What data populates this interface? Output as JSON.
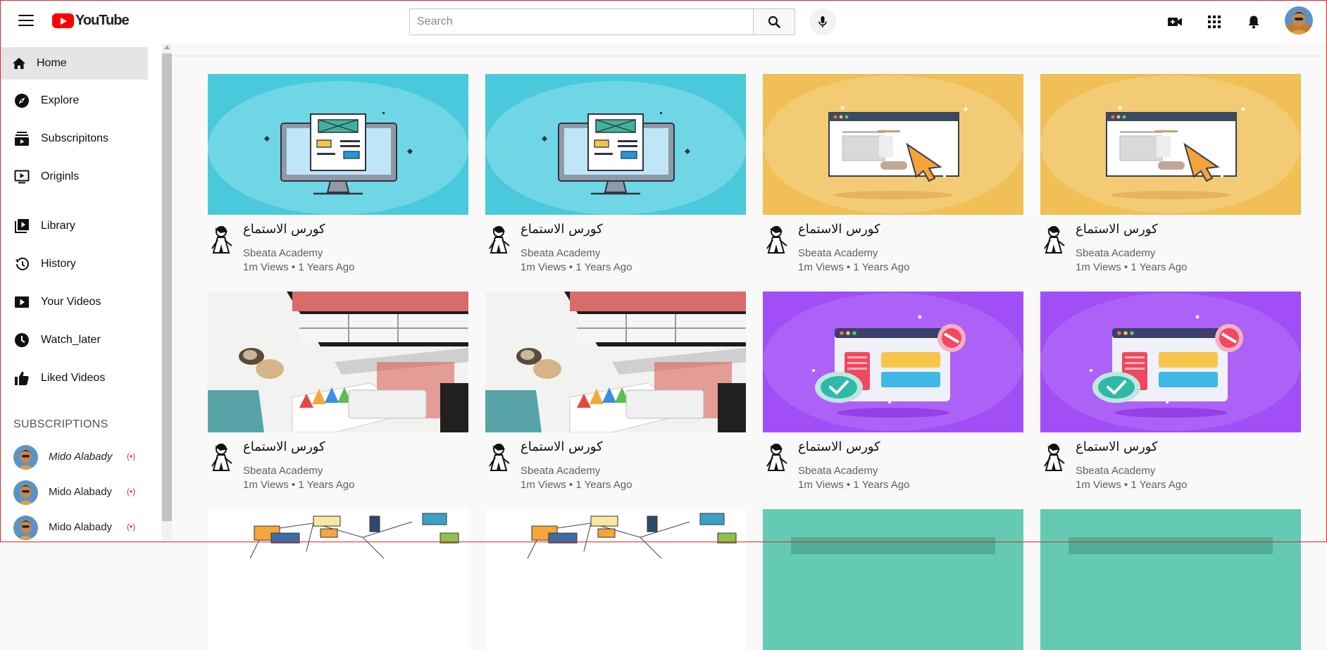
{
  "header": {
    "logo_text": "YouTube",
    "search_placeholder": "Search"
  },
  "sidebar": {
    "items": [
      {
        "label": "Home",
        "icon": "home-icon",
        "active": true
      },
      {
        "label": "Explore",
        "icon": "compass-icon"
      },
      {
        "label": "Subscripitons",
        "icon": "subscriptions-icon"
      },
      {
        "label": "Originls",
        "icon": "originals-icon"
      },
      {
        "label": "Library",
        "icon": "library-icon"
      },
      {
        "label": "History",
        "icon": "history-icon"
      },
      {
        "label": "Your Videos",
        "icon": "your-videos-icon"
      },
      {
        "label": "Watch_later",
        "icon": "clock-icon"
      },
      {
        "label": "Liked Videos",
        "icon": "thumbs-up-icon"
      }
    ],
    "subscriptions_heading": "SUBSCRIPTIONS",
    "subscriptions": [
      {
        "name": "Mido Alabady",
        "live": "(•)"
      },
      {
        "name": "Mido Alabady",
        "live": "(•)"
      },
      {
        "name": "Mido Alabady",
        "live": "(•)"
      }
    ]
  },
  "videos": [
    {
      "title": "كورس الاستماع",
      "channel": "Sbeata Academy",
      "stats": "1m Views • 1 Years Ago",
      "thumb": "computer-cyan"
    },
    {
      "title": "كورس الاستماع",
      "channel": "Sbeata Academy",
      "stats": "1m Views • 1 Years Ago",
      "thumb": "computer-cyan"
    },
    {
      "title": "كورس الاستماع",
      "channel": "Sbeata Academy",
      "stats": "1m Views • 1 Years Ago",
      "thumb": "browser-orange"
    },
    {
      "title": "كورس الاستماع",
      "channel": "Sbeata Academy",
      "stats": "1m Views • 1 Years Ago",
      "thumb": "browser-orange"
    },
    {
      "title": "كورس الاستماع",
      "channel": "Sbeata Academy",
      "stats": "1m Views • 1 Years Ago",
      "thumb": "desk-photo"
    },
    {
      "title": "كورس الاستماع",
      "channel": "Sbeata Academy",
      "stats": "1m Views • 1 Years Ago",
      "thumb": "desk-photo"
    },
    {
      "title": "كورس الاستماع",
      "channel": "Sbeata Academy",
      "stats": "1m Views • 1 Years Ago",
      "thumb": "dashboard-purple"
    },
    {
      "title": "كورس الاستماع",
      "channel": "Sbeata Academy",
      "stats": "1m Views • 1 Years Ago",
      "thumb": "dashboard-purple"
    },
    {
      "title": "",
      "channel": "",
      "stats": "",
      "thumb": "network-diagram"
    },
    {
      "title": "",
      "channel": "",
      "stats": "",
      "thumb": "network-diagram"
    },
    {
      "title": "",
      "channel": "",
      "stats": "",
      "thumb": "teal-banner"
    },
    {
      "title": "",
      "channel": "",
      "stats": "",
      "thumb": "teal-banner"
    }
  ],
  "colors": {
    "brand": "#ff0000",
    "live": "#e02a2a",
    "cyan": "#4ac8dc",
    "orange": "#f0bf55",
    "purple": "#a24ef6",
    "teal": "#5ec8a8"
  }
}
